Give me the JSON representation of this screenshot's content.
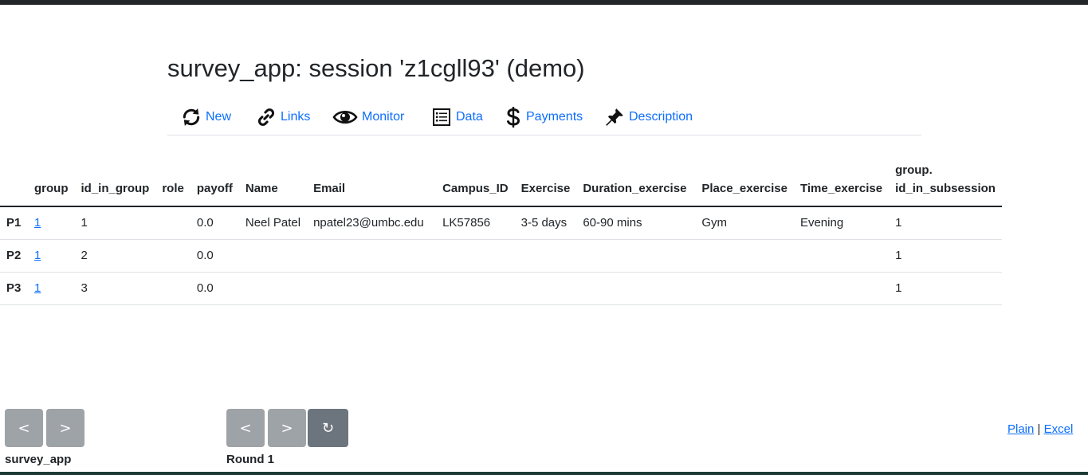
{
  "page": {
    "title": "survey_app: session 'z1cgll93' (demo)"
  },
  "nav": {
    "items": [
      {
        "label": "New",
        "icon": "refresh-icon"
      },
      {
        "label": "Links",
        "icon": "link-icon"
      },
      {
        "label": "Monitor",
        "icon": "eye-icon"
      },
      {
        "label": "Data",
        "icon": "list-icon"
      },
      {
        "label": "Payments",
        "icon": "dollar-icon"
      },
      {
        "label": "Description",
        "icon": "pushpin-icon"
      }
    ]
  },
  "table": {
    "headers": [
      "",
      "group",
      "id_in_group",
      "role",
      "payoff",
      "Name",
      "Email",
      "Campus_ID",
      "Exercise",
      "Duration_exercise",
      "Place_exercise",
      "Time_exercise",
      "group.",
      "id_in_subsession"
    ],
    "rows": [
      {
        "participant": "P1",
        "group": "1",
        "id_in_group": "1",
        "role": "",
        "payoff": "0.0",
        "Name": "Neel Patel",
        "Email": "npatel23@umbc.edu",
        "Campus_ID": "LK57856",
        "Exercise": "3-5 days",
        "Duration_exercise": "60-90 mins",
        "Place_exercise": "Gym",
        "Time_exercise": "Evening",
        "group_id_in_subsession": "1"
      },
      {
        "participant": "P2",
        "group": "1",
        "id_in_group": "2",
        "role": "",
        "payoff": "0.0",
        "Name": "",
        "Email": "",
        "Campus_ID": "",
        "Exercise": "",
        "Duration_exercise": "",
        "Place_exercise": "",
        "Time_exercise": "",
        "group_id_in_subsession": "1"
      },
      {
        "participant": "P3",
        "group": "1",
        "id_in_group": "3",
        "role": "",
        "payoff": "0.0",
        "Name": "",
        "Email": "",
        "Campus_ID": "",
        "Exercise": "",
        "Duration_exercise": "",
        "Place_exercise": "",
        "Time_exercise": "",
        "group_id_in_subsession": "1"
      }
    ]
  },
  "app_nav": {
    "prev": "<",
    "next": ">",
    "label": "survey_app"
  },
  "round_nav": {
    "prev": "<",
    "next": ">",
    "refresh": "↻",
    "label": "Round 1"
  },
  "export": {
    "plain": "Plain",
    "separator": "|",
    "excel": "Excel"
  },
  "colors": {
    "link": "#0d6efd",
    "button": "#9ea3a8",
    "button_dark": "#6c757d"
  }
}
